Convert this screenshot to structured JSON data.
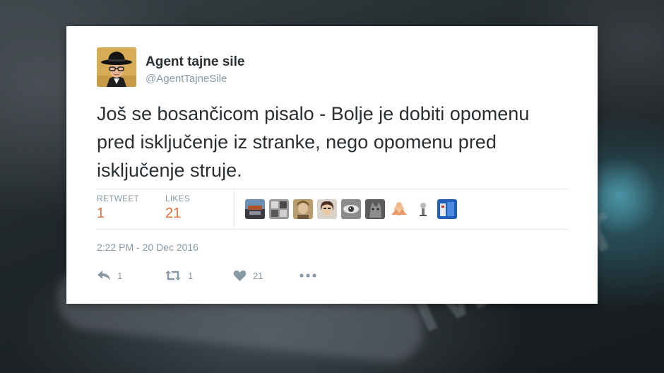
{
  "background": {
    "watermark_word": "Twitter"
  },
  "tweet": {
    "user": {
      "name": "Agent tajne sile",
      "handle": "@AgentTajneSile",
      "avatar_icon": "avatar-man-with-hat-and-glasses"
    },
    "text": "Još se bosančicom pisalo - Bolje je dobiti opomenu pred isključenje iz stranke, nego opomenu pred isključenje struje.",
    "stats": {
      "retweet_label": "RETWEET",
      "retweet_count": "1",
      "likes_label": "LIKES",
      "likes_count": "21"
    },
    "likers": [
      {
        "name": "liker-avatar-1"
      },
      {
        "name": "liker-avatar-2"
      },
      {
        "name": "liker-avatar-3"
      },
      {
        "name": "liker-avatar-4"
      },
      {
        "name": "liker-avatar-5"
      },
      {
        "name": "liker-avatar-6"
      },
      {
        "name": "liker-avatar-7"
      },
      {
        "name": "liker-avatar-8"
      },
      {
        "name": "liker-avatar-9"
      }
    ],
    "timestamp": "2:22 PM - 20 Dec 2016",
    "actions": {
      "reply_count": "1",
      "retweet_count": "1",
      "like_count": "21",
      "reply_icon": "reply-icon",
      "retweet_icon": "retweet-icon",
      "like_icon": "heart-icon",
      "more_icon": "more-icon"
    }
  },
  "colors": {
    "stat_value": "#e0733b",
    "muted": "#8899a6",
    "text": "#292f33",
    "card": "#ffffff"
  }
}
